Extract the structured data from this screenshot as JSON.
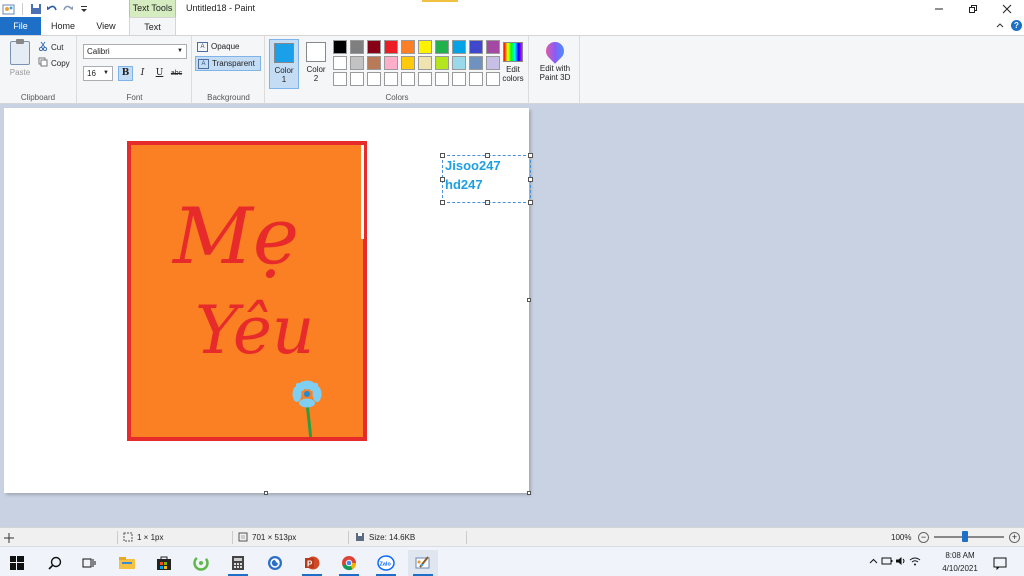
{
  "titlebar": {
    "context_tab": "Text Tools",
    "title": "Untitled18 - Paint",
    "icons": [
      "paint-app-icon",
      "save-icon",
      "undo-icon",
      "redo-icon",
      "customize-qat-icon"
    ],
    "window_buttons": [
      "minimize-icon",
      "restore-icon",
      "close-icon"
    ]
  },
  "tabs": {
    "file": "File",
    "home": "Home",
    "view": "View",
    "text": "Text",
    "active": "Text"
  },
  "ribbon": {
    "clipboard": {
      "label": "Clipboard",
      "paste": "Paste",
      "cut": "Cut",
      "copy": "Copy"
    },
    "font": {
      "label": "Font",
      "family": "Calibri",
      "size": "16",
      "bold": "B",
      "italic": "I",
      "underline": "U",
      "strike": "abc",
      "bold_active": true
    },
    "background": {
      "label": "Background",
      "opaque": "Opaque",
      "transparent": "Transparent",
      "selected": "Transparent"
    },
    "colors": {
      "label": "Colors",
      "color1_line1": "Color",
      "color1_line2": "1",
      "color2_line1": "Color",
      "color2_line2": "2",
      "color1_value": "#1aa0e8",
      "color2_value": "#ffffff",
      "edit_line1": "Edit",
      "edit_line2": "colors",
      "palette": [
        "#000000",
        "#7f7f7f",
        "#880015",
        "#ed1c24",
        "#ff7f27",
        "#fff200",
        "#22b14c",
        "#00a2e8",
        "#3f48cc",
        "#a349a4",
        "#ffffff",
        "#c3c3c3",
        "#b97a57",
        "#ffaec9",
        "#ffc90e",
        "#efe4b0",
        "#b5e61d",
        "#99d9ea",
        "#7092be",
        "#c8bfe7",
        "#ffffff",
        "#ffffff",
        "#ffffff",
        "#ffffff",
        "#ffffff",
        "#ffffff",
        "#ffffff",
        "#ffffff",
        "#ffffff",
        "#ffffff"
      ]
    },
    "paint3d": {
      "line1": "Edit with",
      "line2": "Paint 3D"
    }
  },
  "canvas": {
    "card_background": "#fb7f23",
    "card_border": "#e72a2a",
    "drawn_text_line1": "Mẹ",
    "drawn_text_line2": "Yêu",
    "drawn_text_color": "#e72a2a",
    "flower_petal_color": "#7fcff2",
    "flower_stem_color": "#2a9e3e",
    "textbox_line1": "Jisoo247",
    "textbox_line2": "hd247",
    "textbox_color": "#1ea0e0"
  },
  "statusbar": {
    "cursor": "1 × 1px",
    "dimensions": "701 × 513px",
    "size": "Size: 14.6KB",
    "zoom": "100%",
    "zoom_fraction": 0.44
  },
  "taskbar": {
    "apps": [
      "windows-start-icon",
      "search-icon",
      "task-view-icon",
      "file-explorer-icon",
      "store-icon",
      "green-app-icon",
      "calculator-icon",
      "blue-app-icon",
      "powerpoint-icon",
      "chrome-icon",
      "zalo-icon",
      "paint-icon"
    ],
    "zalo_label": "Zalo",
    "time": "8:08 AM",
    "date": "4/10/2021"
  }
}
